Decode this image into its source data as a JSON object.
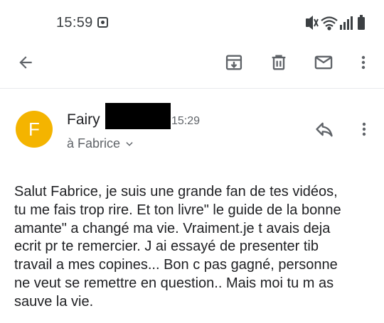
{
  "status_bar": {
    "time": "15:59",
    "icons": [
      "notification-icon",
      "mute-vibrate-icon",
      "wifi-icon",
      "signal-icon",
      "battery-icon"
    ]
  },
  "toolbar": {
    "actions": [
      "back-arrow-icon",
      "archive-icon",
      "delete-icon",
      "mark-unread-icon",
      "more-vert-icon"
    ]
  },
  "email": {
    "avatar_letter": "F",
    "avatar_color": "#f4b400",
    "sender_name": "Fairy",
    "time": "15:29",
    "recipient": "à Fabrice",
    "body_lines": [
      "Salut Fabrice, je suis une grande fan de tes vidéos,",
      "tu me fais trop rire. Et ton livre\" le guide de la bonne",
      "amante\" a changé ma vie. Vraiment.je t avais deja",
      "ecrit pr te remercier. J ai essayé de presenter tib",
      "travail a mes copines... Bon c pas gagné, personne",
      "ne veut se remettre en question.. Mais moi tu m as",
      "sauve la vie."
    ]
  }
}
